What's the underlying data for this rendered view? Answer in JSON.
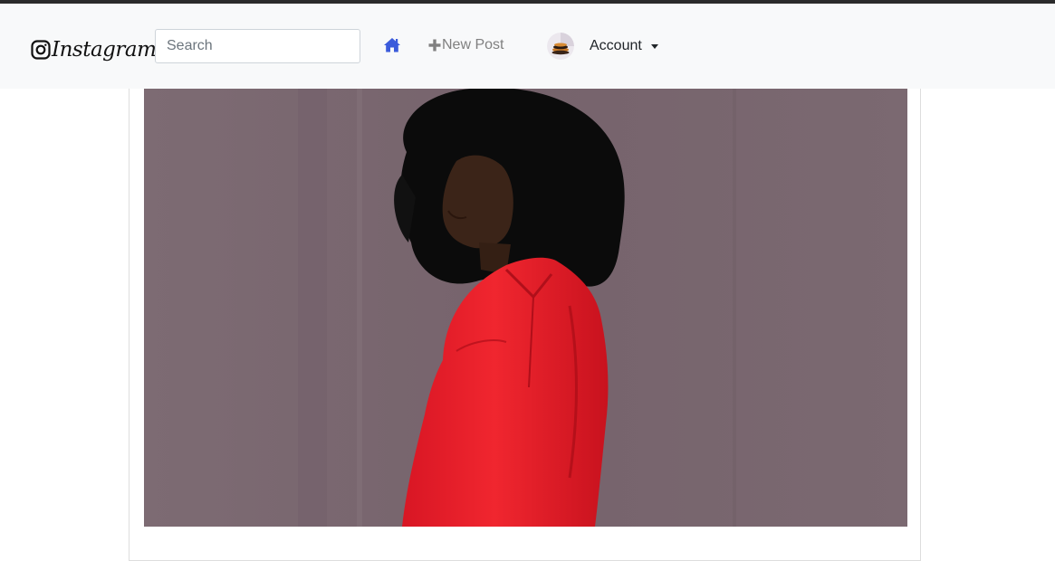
{
  "navbar": {
    "brand": {
      "icon": "instagram-camera-icon",
      "label": "Instagram"
    },
    "search": {
      "placeholder": "Search",
      "value": ""
    },
    "nav": {
      "home_icon": "home-icon",
      "new_post_icon": "plus-icon",
      "new_post_label": "New Post"
    },
    "account": {
      "avatar": "user-avatar",
      "label": "Account",
      "toggle_icon": "caret-down-icon"
    }
  },
  "feed": {
    "post": {
      "image": "photo-of-woman-with-afro-in-red-jumpsuit-against-mauve-wall"
    }
  },
  "colors": {
    "navbar_bg": "#f8f9fa",
    "home_icon": "#3b5bdb",
    "nav_link": "#808080",
    "wall": "#7a6870",
    "jumpsuit": "#e8202b"
  }
}
